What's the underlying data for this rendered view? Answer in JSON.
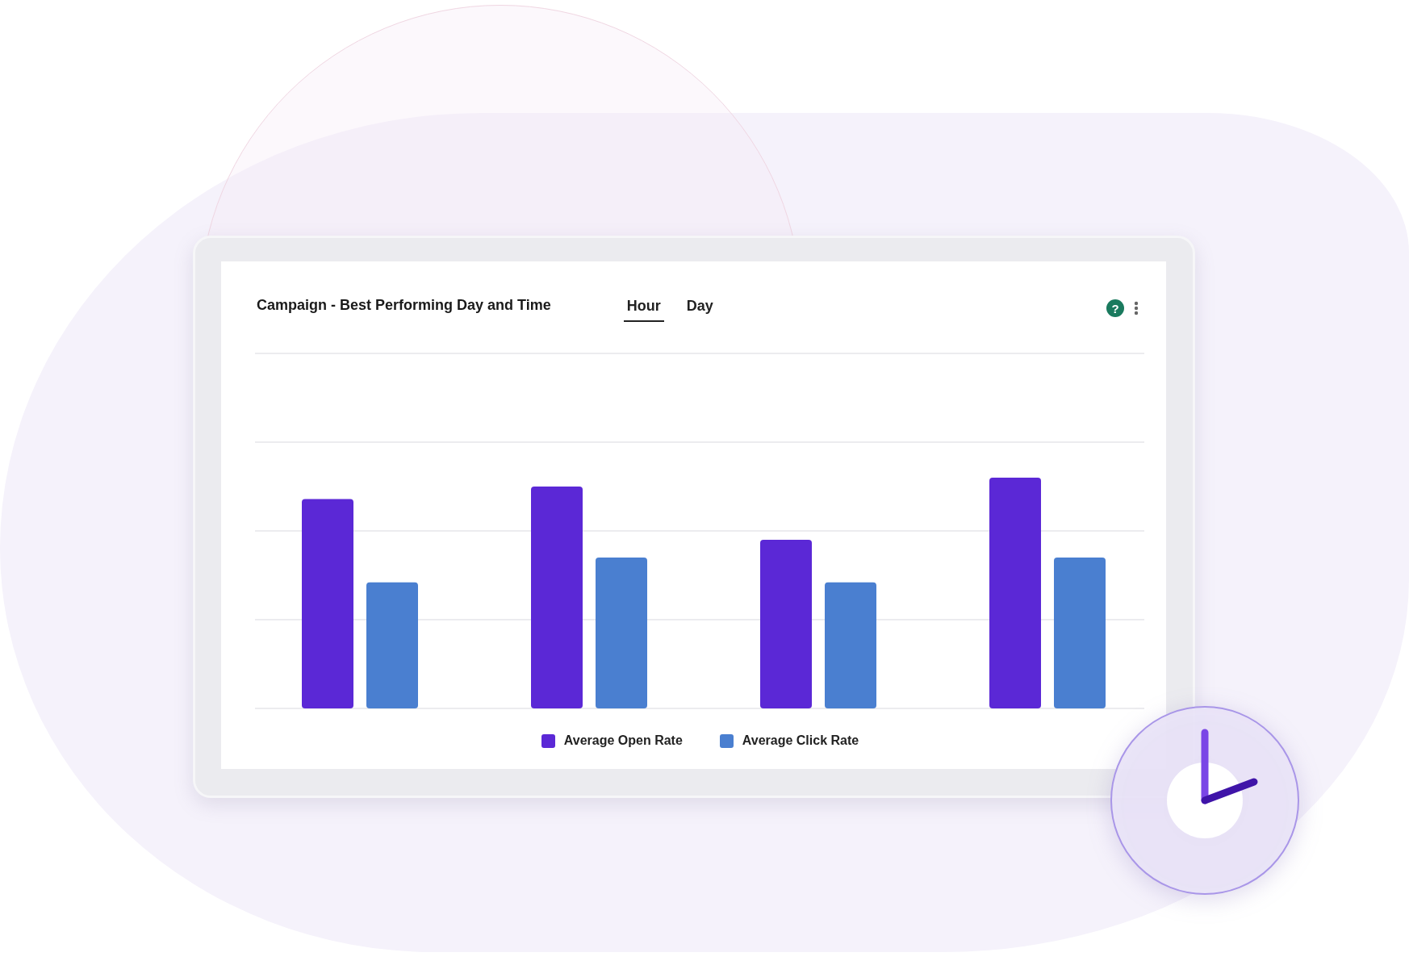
{
  "card": {
    "title": "Campaign - Best Performing Day and Time",
    "help": "?"
  },
  "tabs": [
    {
      "label": "Hour",
      "selected": true
    },
    {
      "label": "Day",
      "selected": false
    }
  ],
  "legend": [
    {
      "label": "Average Open Rate",
      "color": "#5b28d6"
    },
    {
      "label": "Average Click Rate",
      "color": "#4a7fd0"
    }
  ]
}
